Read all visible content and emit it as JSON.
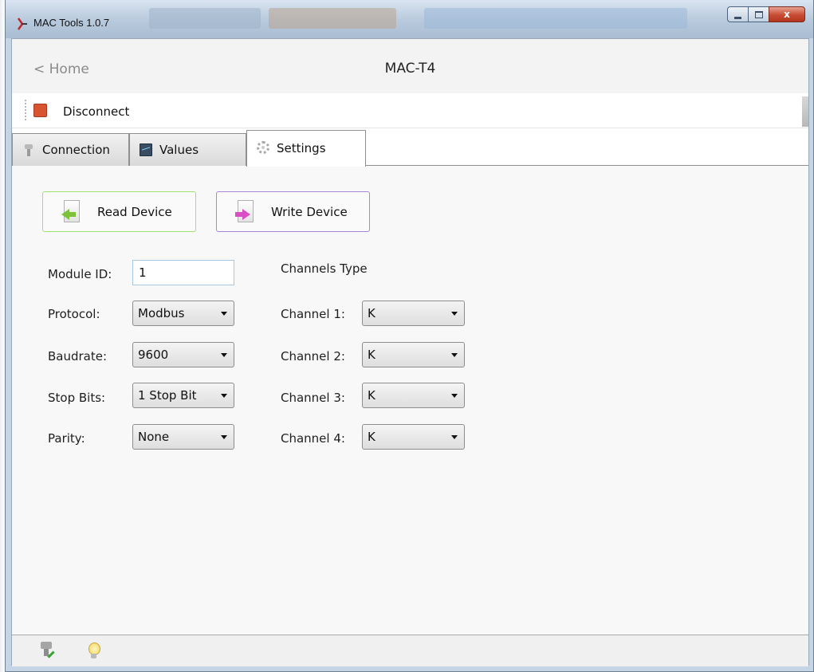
{
  "window": {
    "title": "MAC Tools 1.0.7",
    "close_glyph": "x"
  },
  "nav": {
    "home_label": "< Home",
    "page_title": "MAC-T4"
  },
  "toolbar": {
    "disconnect_label": "Disconnect"
  },
  "tabs": [
    {
      "label": "Connection",
      "icon": "plug-icon"
    },
    {
      "label": "Values",
      "icon": "monitor-icon"
    },
    {
      "label": "Settings",
      "icon": "gear-icon",
      "active": true
    }
  ],
  "settings": {
    "read_button_label": "Read Device",
    "write_button_label": "Write Device",
    "module_id_label": "Module ID:",
    "module_id_value": "1",
    "protocol_label": "Protocol:",
    "protocol_value": "Modbus",
    "baudrate_label": "Baudrate:",
    "baudrate_value": "9600",
    "stop_bits_label": "Stop Bits:",
    "stop_bits_value": "1 Stop Bit",
    "parity_label": "Parity:",
    "parity_value": "None",
    "channels_type_label": "Channels Type",
    "channels": [
      {
        "label": "Channel 1:",
        "value": "K"
      },
      {
        "label": "Channel 2:",
        "value": "K"
      },
      {
        "label": "Channel 3:",
        "value": "K"
      },
      {
        "label": "Channel 4:",
        "value": "K"
      }
    ]
  },
  "colors": {
    "read_border": "#9ee36f",
    "write_border": "#a987d8",
    "disconnect_icon": "#d8532f"
  }
}
